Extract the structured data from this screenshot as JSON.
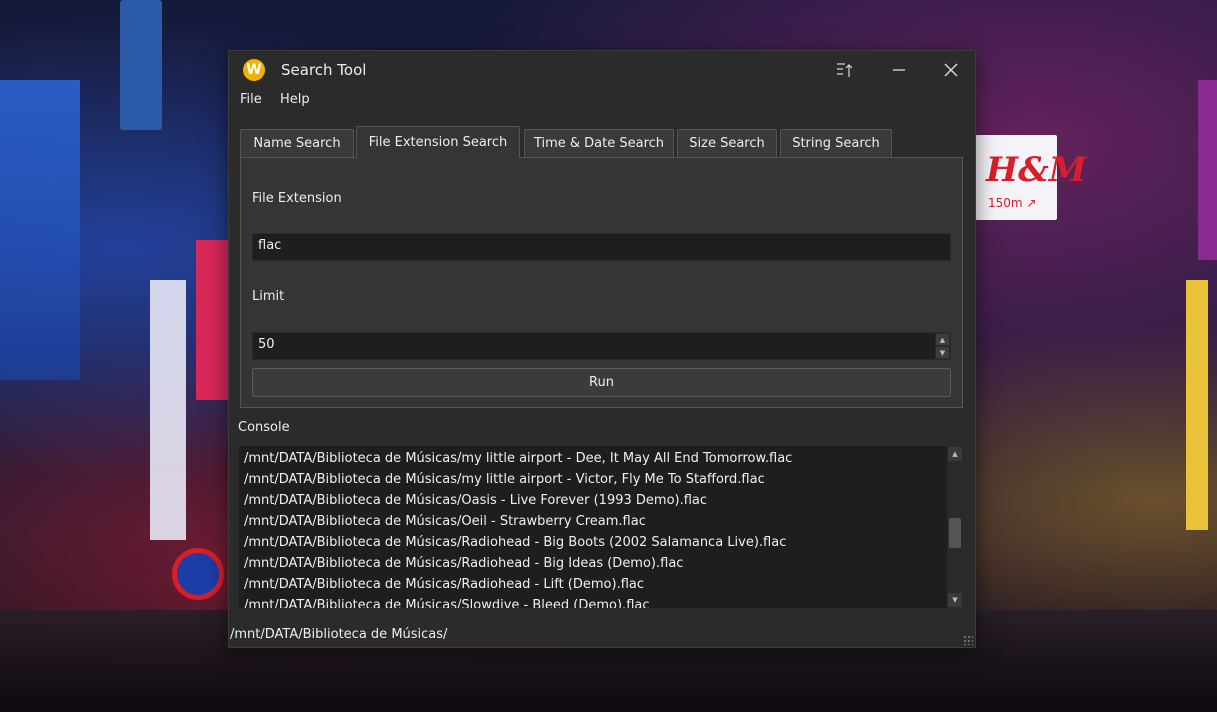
{
  "window": {
    "title": "Search Tool",
    "app_icon_letter": "W",
    "controls": {
      "pin_icon": "↑",
      "minimize_icon": "—",
      "close_icon": "✕"
    }
  },
  "menubar": {
    "items": [
      {
        "label": "File"
      },
      {
        "label": "Help"
      }
    ]
  },
  "tabs": [
    {
      "label": "Name Search",
      "active": false
    },
    {
      "label": "File Extension Search",
      "active": true
    },
    {
      "label": "Time & Date Search",
      "active": false
    },
    {
      "label": "Size Search",
      "active": false
    },
    {
      "label": "String Search",
      "active": false
    }
  ],
  "form": {
    "extension_label": "File Extension",
    "extension_value": "flac",
    "limit_label": "Limit",
    "limit_value": "50",
    "run_label": "Run"
  },
  "console": {
    "label": "Console",
    "lines": [
      "/mnt/DATA/Biblioteca de Músicas/my little airport - Dee, It May All End Tomorrow.flac",
      "/mnt/DATA/Biblioteca de Músicas/my little airport - Victor, Fly Me To Stafford.flac",
      "/mnt/DATA/Biblioteca de Músicas/Oasis - Live Forever (1993 Demo).flac",
      "/mnt/DATA/Biblioteca de Músicas/Oeil - Strawberry Cream.flac",
      "/mnt/DATA/Biblioteca de Músicas/Radiohead - Big Boots (2002 Salamanca Live).flac",
      "/mnt/DATA/Biblioteca de Músicas/Radiohead - Big Ideas (Demo).flac",
      "/mnt/DATA/Biblioteca de Músicas/Radiohead - Lift (Demo).flac",
      "/mnt/DATA/Biblioteca de Músicas/Slowdive - Bleed (Demo).flac"
    ]
  },
  "status": {
    "path": "/mnt/DATA/Biblioteca de Músicas/"
  },
  "background": {
    "hm_logo": "H&M",
    "hm_distance": "150m ↗"
  },
  "colors": {
    "window_bg": "#2b2b2b",
    "panel_bg": "#353535",
    "input_bg": "#1e1e1e",
    "text": "#ededed",
    "app_icon": "#f0b400"
  }
}
